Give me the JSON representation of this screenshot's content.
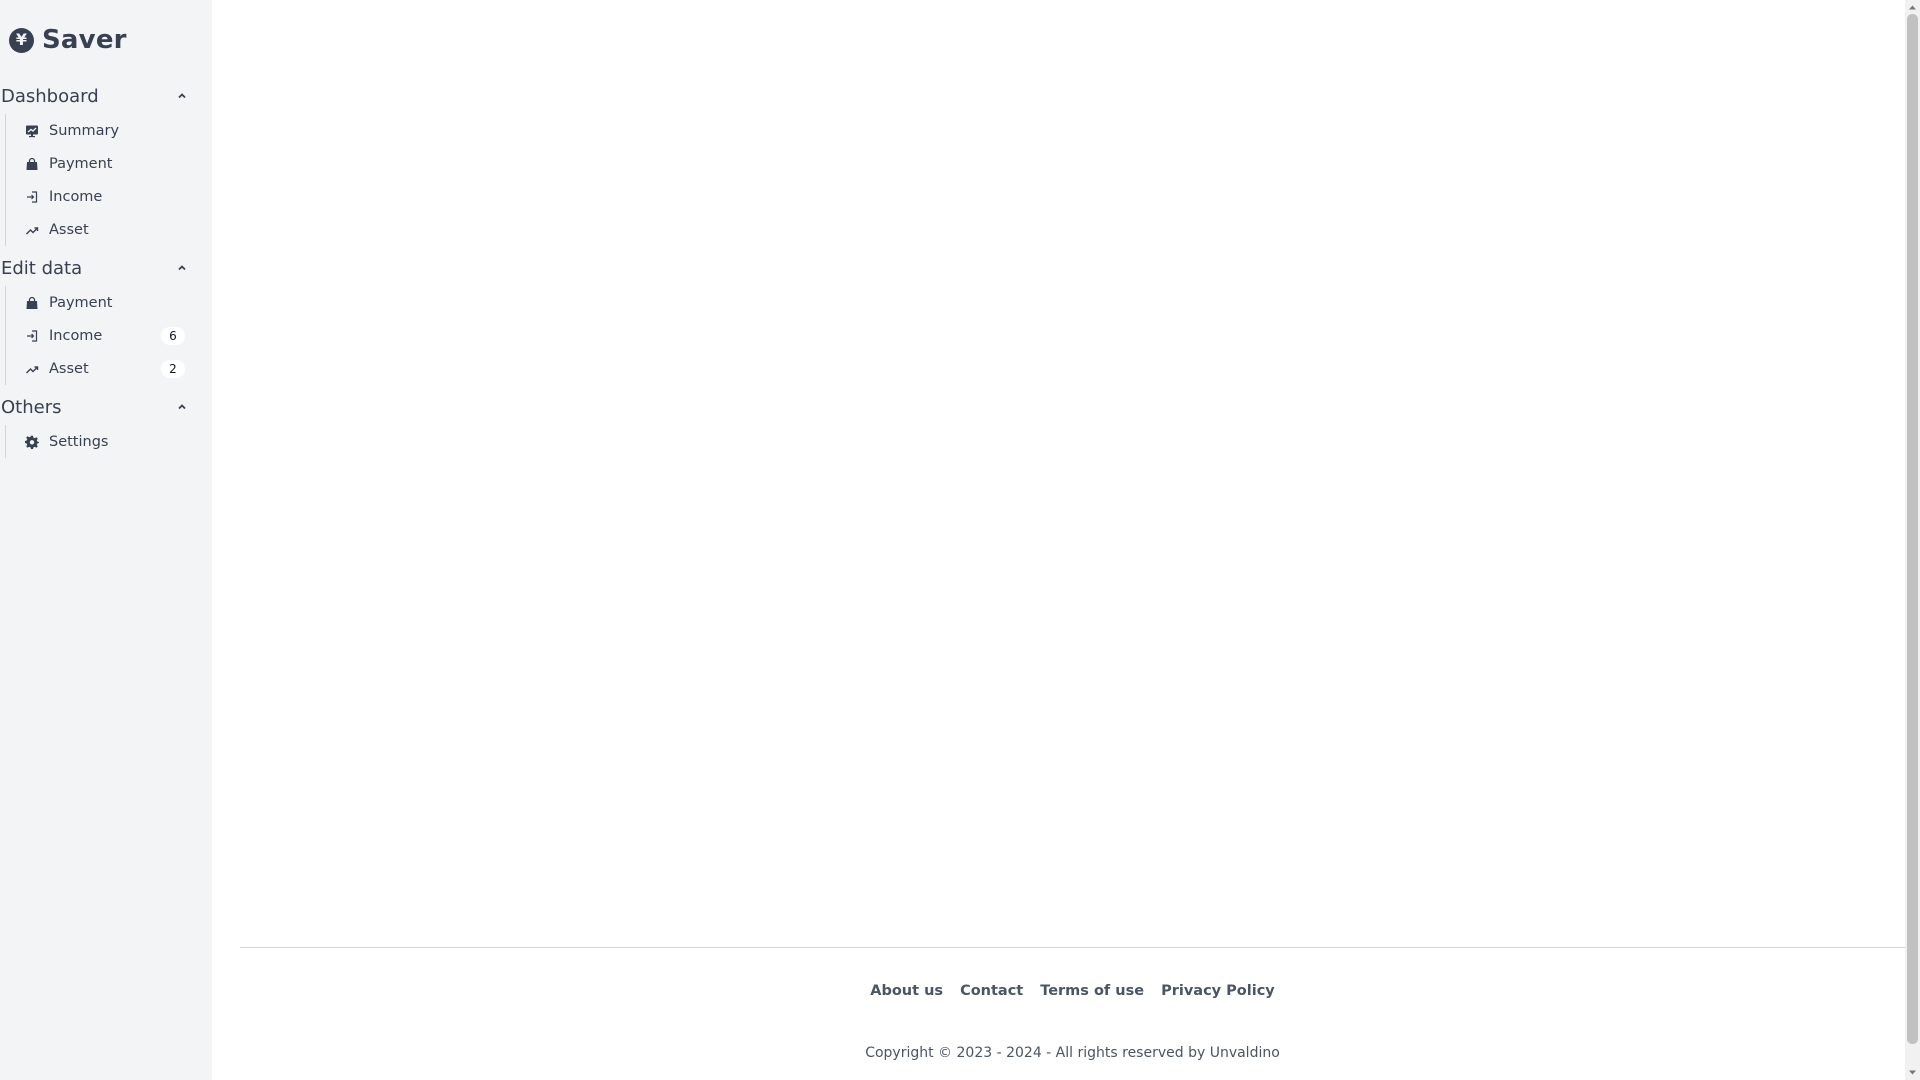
{
  "brand": {
    "name": "Saver",
    "icon": "yen-icon",
    "symbol": "¥"
  },
  "sections": [
    {
      "title": "Dashboard",
      "items": [
        {
          "label": "Summary",
          "icon": "chart-icon"
        },
        {
          "label": "Payment",
          "icon": "bag-icon"
        },
        {
          "label": "Income",
          "icon": "login-icon"
        },
        {
          "label": "Asset",
          "icon": "trend-up-icon"
        }
      ]
    },
    {
      "title": "Edit data",
      "items": [
        {
          "label": "Payment",
          "icon": "bag-icon"
        },
        {
          "label": "Income",
          "icon": "login-icon",
          "badge": "6"
        },
        {
          "label": "Asset",
          "icon": "trend-up-icon",
          "badge": "2"
        }
      ]
    },
    {
      "title": "Others",
      "items": [
        {
          "label": "Settings",
          "icon": "gear-icon"
        }
      ]
    }
  ],
  "footer": {
    "links": [
      "About us",
      "Contact",
      "Terms of use",
      "Privacy Policy"
    ],
    "copyright": "Copyright © 2023 - 2024 - All rights reserved by Unvaldino"
  },
  "colors": {
    "sidebar_bg": "#f3f4f6",
    "text": "#374151",
    "footer_text": "#4b5563"
  }
}
